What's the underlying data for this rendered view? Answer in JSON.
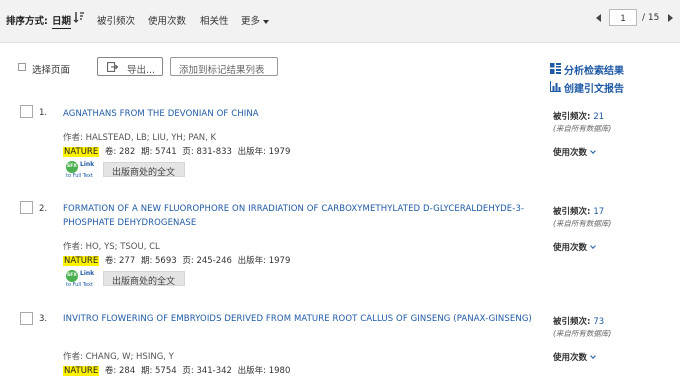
{
  "sort": {
    "label": "排序方式:",
    "active": "日期",
    "options": [
      "被引频次",
      "使用次数",
      "相关性"
    ],
    "more": "更多"
  },
  "pager": {
    "current": "1",
    "total": "/ 15"
  },
  "toolbar": {
    "select_page": "选择页面",
    "export": "导出...",
    "add_marked": "添加到标记结果列表"
  },
  "side": {
    "analyze": "分析检索结果",
    "citation_report": "创建引文报告"
  },
  "labels": {
    "authors_prefix": "作者:",
    "volume": "卷:",
    "issue": "期:",
    "pages": "页:",
    "year": "出版年:",
    "times_cited": "被引频次:",
    "all_databases": "(来自所有数据库)",
    "usage_count": "使用次数",
    "full_text": "出版商处的全文",
    "sfx_link": "Link",
    "sfx_full": "to Full Text",
    "sfx_logo": "SFX"
  },
  "records": [
    {
      "num": "1.",
      "title": "AGNATHANS FROM THE DEVONIAN OF CHINA",
      "authors": "HALSTEAD, LB; LIU, YH; PAN, K",
      "journal": "NATURE",
      "volume": "282",
      "issue": "5741",
      "pages": "831-833",
      "year": "1979",
      "cited": "21"
    },
    {
      "num": "2.",
      "title": "FORMATION OF A NEW FLUOROPHORE ON IRRADIATION OF CARBOXYMETHYLATED D-GLYCERALDEHYDE-3-PHOSPHATE DEHYDROGENASE",
      "authors": "HO, YS; TSOU, CL",
      "journal": "NATURE",
      "volume": "277",
      "issue": "5693",
      "pages": "245-246",
      "year": "1979",
      "cited": "17"
    },
    {
      "num": "3.",
      "title": "INVITRO FLOWERING OF EMBRYOIDS DERIVED FROM MATURE ROOT CALLUS OF GINSENG (PANAX-GINSENG)",
      "authors": "CHANG, W; HSING, Y",
      "journal": "NATURE",
      "volume": "284",
      "issue": "5754",
      "pages": "341-342",
      "year": "1980",
      "cited": "73"
    }
  ]
}
